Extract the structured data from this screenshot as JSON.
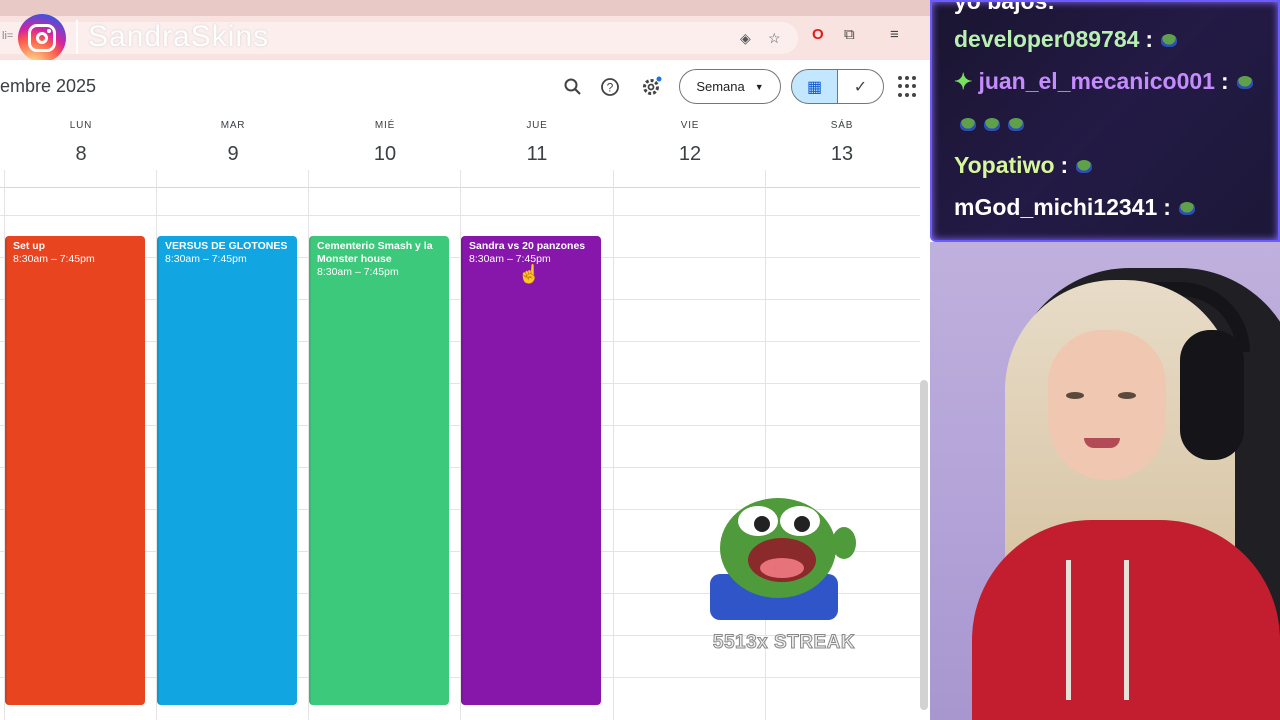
{
  "browser": {
    "url_fragment": "li=",
    "toolbar_icons": [
      "extension-icon",
      "bookmark-star-icon",
      "opera-icon",
      "puzzle-icon",
      "media-icon"
    ]
  },
  "overlay": {
    "instagram_handle": "SandraSkins"
  },
  "calendar": {
    "month_label": "embre 2025",
    "view_selector": "Semana",
    "days": [
      {
        "dow": "LUN",
        "num": "8"
      },
      {
        "dow": "MAR",
        "num": "9"
      },
      {
        "dow": "MIÉ",
        "num": "10"
      },
      {
        "dow": "JUE",
        "num": "11"
      },
      {
        "dow": "VIE",
        "num": "12"
      },
      {
        "dow": "SÁB",
        "num": "13"
      }
    ],
    "events": [
      {
        "title": "Set up",
        "time": "8:30am – 7:45pm",
        "color": "#e8441f"
      },
      {
        "title": "VERSUS DE GLOTONES",
        "time": "8:30am – 7:45pm",
        "color": "#11a5e2"
      },
      {
        "title": "Cementerio Smash y la Monster house",
        "time": "8:30am – 7:45pm",
        "color": "#3dc97b"
      },
      {
        "title": "Sandra vs 20 panzones",
        "time": "8:30am – 7:45pm",
        "color": "#8716ab"
      }
    ]
  },
  "stream": {
    "emote_streak": "5513x STREAK",
    "chat": [
      {
        "user": "yo bajos:",
        "color": "#ffffff"
      },
      {
        "user": "developer089784",
        "color": "#b7f0b0"
      },
      {
        "user": "juan_el_mecanico001",
        "color": "#c58cff"
      },
      {
        "user": "Yopatiwo",
        "color": "#d6f79a"
      },
      {
        "user": "mGod_michi12341",
        "color": "#ffffff"
      }
    ]
  }
}
